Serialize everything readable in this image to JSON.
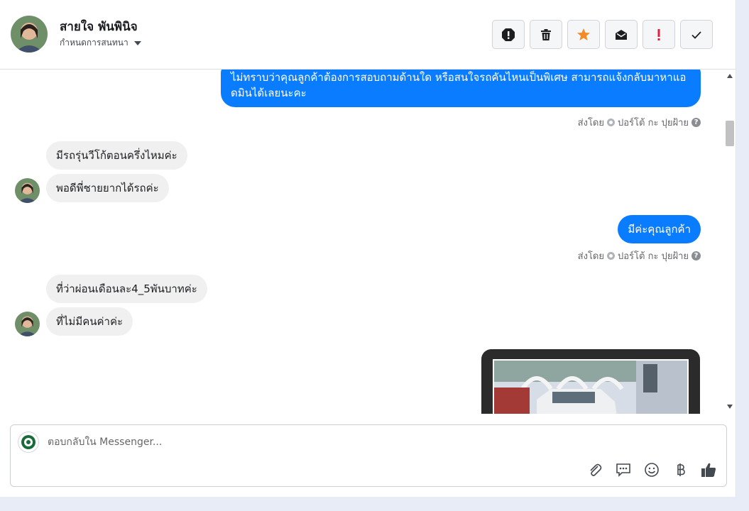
{
  "header": {
    "contact_name": "สายใจ พันพินิจ",
    "assign_label": "กำหนดการสนทนา",
    "actions": [
      {
        "icon": "alert-circle-icon",
        "name": "mark-spam-button"
      },
      {
        "icon": "trash-icon",
        "name": "delete-button"
      },
      {
        "icon": "star-icon",
        "name": "star-button",
        "color": "#f28c28"
      },
      {
        "icon": "mark-unread-icon",
        "name": "mark-unread-button"
      },
      {
        "icon": "exclamation-icon",
        "name": "follow-up-button",
        "color": "#e41e3f"
      },
      {
        "icon": "checkmark-icon",
        "name": "done-button"
      }
    ]
  },
  "messages": {
    "out_1": "ไม่ทราบว่าคุณลูกค้าต้องการสอบถามด้านใด หรือสนใจรถคันไหนเป็นพิเศษ สามารถแจ้งกลับมาหาแอดมินได้เลยนะคะ",
    "sent_by_1": "ส่งโดย",
    "sender_1": "ปอร์โต้ กะ ปุยฝ้าย",
    "in_1": "มีรถรุ่นวีโก้ตอนครึ่งไหมค่ะ",
    "in_2": "พอดีพี่ชายยากได้รถค่ะ",
    "out_2": "มีค่ะคุณลูกค้า",
    "sent_by_2": "ส่งโดย",
    "sender_2": "ปอร์โต้ กะ ปุยฝ้าย",
    "in_3": "ที่ว่าผ่อนเดือนละ4_5พันบาทค่ะ",
    "in_4": "ที่ไม่มีคนค่าค่ะ"
  },
  "composer": {
    "placeholder": "ตอบกลับใน Messenger...",
    "tools": [
      "paperclip-icon",
      "chat-bubble-icon",
      "emoji-icon",
      "baht-icon",
      "thumbs-up-icon"
    ]
  },
  "colors": {
    "outgoing": "#0a7cff",
    "incoming": "#f0f0f0",
    "star": "#f28c28",
    "alert": "#e41e3f"
  }
}
